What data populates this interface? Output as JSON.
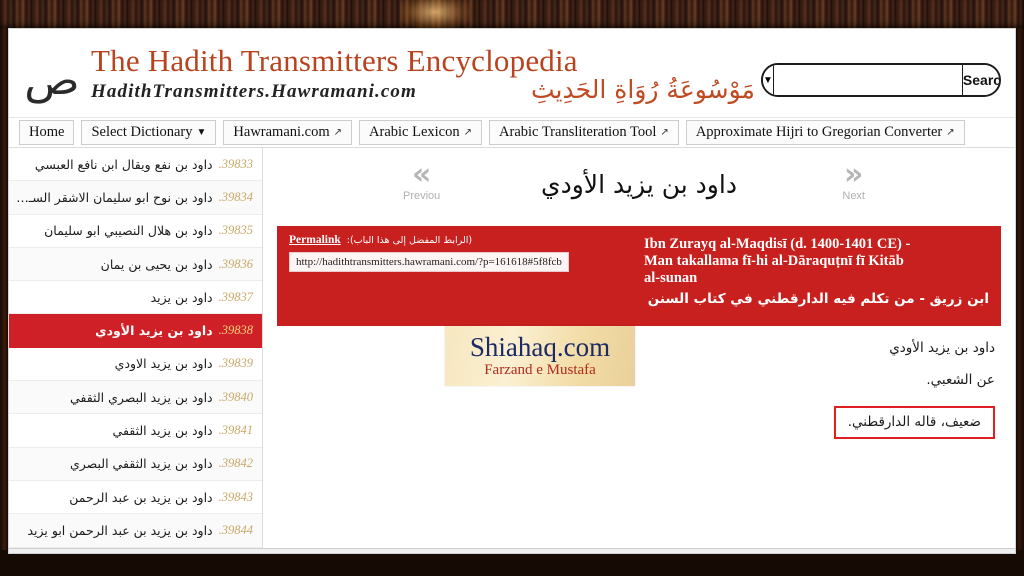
{
  "site": {
    "title": "The Hadith Transmitters Encyclopedia",
    "subtitle": "HadithTransmitters.Hawramani.com",
    "subtitle_arabic": "مَوْسُوعَةُ رُوَاةِ الحَدِيثِ",
    "logo_glyph": "ص",
    "logo_icon_name": "arabic-calligraphy-logo"
  },
  "search": {
    "scope_caret": "▼",
    "value": "",
    "placeholder": "",
    "button_label": "Search"
  },
  "nav": {
    "items": [
      {
        "label": "Home",
        "external": false,
        "caret": false
      },
      {
        "label": "Select Dictionary",
        "external": false,
        "caret": true
      },
      {
        "label": "Hawramani.com",
        "external": true,
        "caret": false
      },
      {
        "label": "Arabic Lexicon",
        "external": true,
        "caret": false
      },
      {
        "label": "Arabic Transliteration Tool",
        "external": true,
        "caret": false
      },
      {
        "label": "Approximate Hijri to Gregorian Converter",
        "external": true,
        "caret": false
      }
    ],
    "external_glyph": "↗",
    "caret_glyph": "▼"
  },
  "sidebar": {
    "items": [
      {
        "num": "39833.",
        "label": "داود بن نفع ويقال ابن نافع العبسي",
        "active": false
      },
      {
        "num": "39834.",
        "label": "داود بن نوح ابو سليمان الاشقر السـمـار...",
        "active": false
      },
      {
        "num": "39835.",
        "label": "داود بن هلال النصيبي ابو سليمان",
        "active": false
      },
      {
        "num": "39836.",
        "label": "داود بن يحيى بن يمان",
        "active": false
      },
      {
        "num": "39837.",
        "label": "داود بن يزيد",
        "active": false
      },
      {
        "num": "39838.",
        "label": "داود بن يزيد الأودي",
        "active": true
      },
      {
        "num": "39839.",
        "label": "داود بن يزيد الاودي",
        "active": false
      },
      {
        "num": "39840.",
        "label": "داود بن يزيد البصري الثقفي",
        "active": false
      },
      {
        "num": "39841.",
        "label": "داود بن يزيد الثقفي",
        "active": false
      },
      {
        "num": "39842.",
        "label": "داود بن يزيد الثقفي البصري",
        "active": false
      },
      {
        "num": "39843.",
        "label": "داود بن يزيد بن عبد الرحمن",
        "active": false
      },
      {
        "num": "39844.",
        "label": "داود بن يزيد بن عبد الرحمن ابو يزيد",
        "active": false
      }
    ]
  },
  "entry": {
    "title": "داود بن يزيد الأودي",
    "prev_label": "Previou",
    "next_label": "Next",
    "prev_glyph": "«",
    "next_glyph": "»"
  },
  "permalink": {
    "label": "Permalink",
    "arabic_note": "(الرابط المفضل إلى هذا الباب):",
    "url": "http://hadithtransmitters.hawramani.com/?p=161618#5f8fcb"
  },
  "source_heading": {
    "english_line_1": "Ibn Zurayq al-Maqdisī (d. 1400-1401 CE) -",
    "english_line_2": "Man takallama fī-hi al-Dāraquṭnī fī Kitāb",
    "english_line_3": "al-sunan",
    "arabic": "ابن زريق - من تكلم فيه الدارقطني في كتاب السنن"
  },
  "entry_body": {
    "lines": [
      "داود بن يزيد الأودي",
      "عن الشعبي."
    ],
    "boxed_line": "ضعيف، قاله الدارقطني."
  },
  "watermark": {
    "main": "Shiahaq.com",
    "sub": "Farzand e Mustafa"
  },
  "colors": {
    "brand_red": "#b8431f",
    "panel_red": "#c8201f",
    "active_red": "#cf2027",
    "highlight_box": "#e02020",
    "number_gold": "#c8a86a"
  }
}
